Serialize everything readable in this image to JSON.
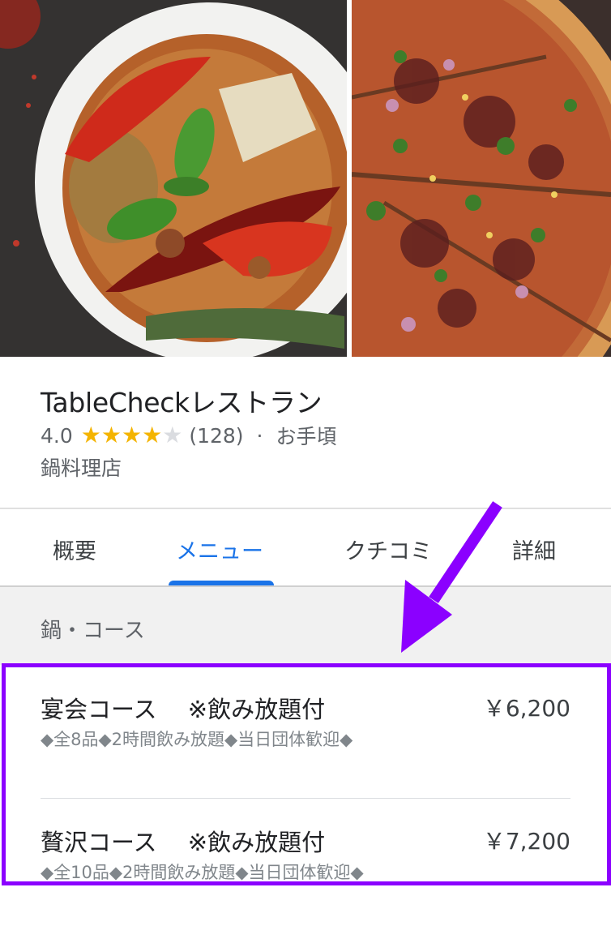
{
  "place": {
    "name": "TableCheckレストラン",
    "rating": "4.0",
    "stars_filled": 4,
    "stars_total": 5,
    "review_count": "(128)",
    "separator": "·",
    "price_level": "お手頃",
    "category": "鍋料理店"
  },
  "tabs": [
    {
      "label": "概要",
      "active": false
    },
    {
      "label": "メニュー",
      "active": true
    },
    {
      "label": "クチコミ",
      "active": false
    },
    {
      "label": "詳細",
      "active": false
    }
  ],
  "menu": {
    "section_title": "鍋・コース",
    "items": [
      {
        "title": "宴会コース　 ※飲み放題付",
        "price": "￥6,200",
        "description": "◆全8品◆2時間飲み放題◆当日団体歓迎◆"
      },
      {
        "title": "贅沢コース　 ※飲み放題付",
        "price": "￥7,200",
        "description": "◆全10品◆2時間飲み放題◆当日団体歓迎◆"
      }
    ]
  },
  "colors": {
    "accent": "#1a73e8",
    "star": "#f4b400",
    "annotation": "#8b00ff"
  },
  "icons": [
    "star-icon",
    "annotation-arrow"
  ]
}
